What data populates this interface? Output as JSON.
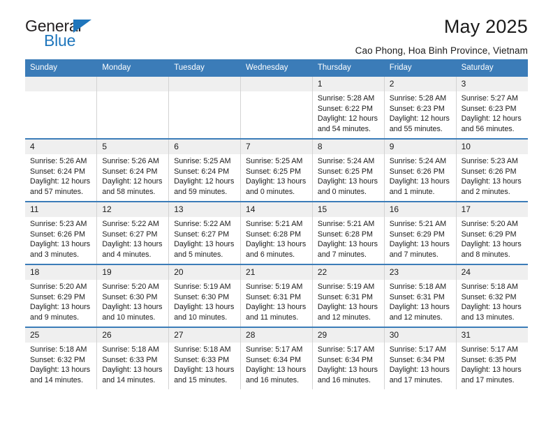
{
  "brand": {
    "name_top": "General",
    "name_bottom": "Blue",
    "accent_color": "#1f76bc"
  },
  "header": {
    "title": "May 2025",
    "subtitle": "Cao Phong, Hoa Binh Province, Vietnam"
  },
  "calendar": {
    "header_bg": "#3b7cb8",
    "daynum_bg": "#efefef",
    "weekday_headers": [
      "Sunday",
      "Monday",
      "Tuesday",
      "Wednesday",
      "Thursday",
      "Friday",
      "Saturday"
    ],
    "labels": {
      "sunrise": "Sunrise:",
      "sunset": "Sunset:",
      "daylight": "Daylight:"
    },
    "weeks": [
      [
        {
          "day": "",
          "empty": true
        },
        {
          "day": "",
          "empty": true
        },
        {
          "day": "",
          "empty": true
        },
        {
          "day": "",
          "empty": true
        },
        {
          "day": "1",
          "sunrise": "Sunrise: 5:28 AM",
          "sunset": "Sunset: 6:22 PM",
          "daylight": "Daylight: 12 hours and 54 minutes."
        },
        {
          "day": "2",
          "sunrise": "Sunrise: 5:28 AM",
          "sunset": "Sunset: 6:23 PM",
          "daylight": "Daylight: 12 hours and 55 minutes."
        },
        {
          "day": "3",
          "sunrise": "Sunrise: 5:27 AM",
          "sunset": "Sunset: 6:23 PM",
          "daylight": "Daylight: 12 hours and 56 minutes."
        }
      ],
      [
        {
          "day": "4",
          "sunrise": "Sunrise: 5:26 AM",
          "sunset": "Sunset: 6:24 PM",
          "daylight": "Daylight: 12 hours and 57 minutes."
        },
        {
          "day": "5",
          "sunrise": "Sunrise: 5:26 AM",
          "sunset": "Sunset: 6:24 PM",
          "daylight": "Daylight: 12 hours and 58 minutes."
        },
        {
          "day": "6",
          "sunrise": "Sunrise: 5:25 AM",
          "sunset": "Sunset: 6:24 PM",
          "daylight": "Daylight: 12 hours and 59 minutes."
        },
        {
          "day": "7",
          "sunrise": "Sunrise: 5:25 AM",
          "sunset": "Sunset: 6:25 PM",
          "daylight": "Daylight: 13 hours and 0 minutes."
        },
        {
          "day": "8",
          "sunrise": "Sunrise: 5:24 AM",
          "sunset": "Sunset: 6:25 PM",
          "daylight": "Daylight: 13 hours and 0 minutes."
        },
        {
          "day": "9",
          "sunrise": "Sunrise: 5:24 AM",
          "sunset": "Sunset: 6:26 PM",
          "daylight": "Daylight: 13 hours and 1 minute."
        },
        {
          "day": "10",
          "sunrise": "Sunrise: 5:23 AM",
          "sunset": "Sunset: 6:26 PM",
          "daylight": "Daylight: 13 hours and 2 minutes."
        }
      ],
      [
        {
          "day": "11",
          "sunrise": "Sunrise: 5:23 AM",
          "sunset": "Sunset: 6:26 PM",
          "daylight": "Daylight: 13 hours and 3 minutes."
        },
        {
          "day": "12",
          "sunrise": "Sunrise: 5:22 AM",
          "sunset": "Sunset: 6:27 PM",
          "daylight": "Daylight: 13 hours and 4 minutes."
        },
        {
          "day": "13",
          "sunrise": "Sunrise: 5:22 AM",
          "sunset": "Sunset: 6:27 PM",
          "daylight": "Daylight: 13 hours and 5 minutes."
        },
        {
          "day": "14",
          "sunrise": "Sunrise: 5:21 AM",
          "sunset": "Sunset: 6:28 PM",
          "daylight": "Daylight: 13 hours and 6 minutes."
        },
        {
          "day": "15",
          "sunrise": "Sunrise: 5:21 AM",
          "sunset": "Sunset: 6:28 PM",
          "daylight": "Daylight: 13 hours and 7 minutes."
        },
        {
          "day": "16",
          "sunrise": "Sunrise: 5:21 AM",
          "sunset": "Sunset: 6:29 PM",
          "daylight": "Daylight: 13 hours and 7 minutes."
        },
        {
          "day": "17",
          "sunrise": "Sunrise: 5:20 AM",
          "sunset": "Sunset: 6:29 PM",
          "daylight": "Daylight: 13 hours and 8 minutes."
        }
      ],
      [
        {
          "day": "18",
          "sunrise": "Sunrise: 5:20 AM",
          "sunset": "Sunset: 6:29 PM",
          "daylight": "Daylight: 13 hours and 9 minutes."
        },
        {
          "day": "19",
          "sunrise": "Sunrise: 5:20 AM",
          "sunset": "Sunset: 6:30 PM",
          "daylight": "Daylight: 13 hours and 10 minutes."
        },
        {
          "day": "20",
          "sunrise": "Sunrise: 5:19 AM",
          "sunset": "Sunset: 6:30 PM",
          "daylight": "Daylight: 13 hours and 10 minutes."
        },
        {
          "day": "21",
          "sunrise": "Sunrise: 5:19 AM",
          "sunset": "Sunset: 6:31 PM",
          "daylight": "Daylight: 13 hours and 11 minutes."
        },
        {
          "day": "22",
          "sunrise": "Sunrise: 5:19 AM",
          "sunset": "Sunset: 6:31 PM",
          "daylight": "Daylight: 13 hours and 12 minutes."
        },
        {
          "day": "23",
          "sunrise": "Sunrise: 5:18 AM",
          "sunset": "Sunset: 6:31 PM",
          "daylight": "Daylight: 13 hours and 12 minutes."
        },
        {
          "day": "24",
          "sunrise": "Sunrise: 5:18 AM",
          "sunset": "Sunset: 6:32 PM",
          "daylight": "Daylight: 13 hours and 13 minutes."
        }
      ],
      [
        {
          "day": "25",
          "sunrise": "Sunrise: 5:18 AM",
          "sunset": "Sunset: 6:32 PM",
          "daylight": "Daylight: 13 hours and 14 minutes."
        },
        {
          "day": "26",
          "sunrise": "Sunrise: 5:18 AM",
          "sunset": "Sunset: 6:33 PM",
          "daylight": "Daylight: 13 hours and 14 minutes."
        },
        {
          "day": "27",
          "sunrise": "Sunrise: 5:18 AM",
          "sunset": "Sunset: 6:33 PM",
          "daylight": "Daylight: 13 hours and 15 minutes."
        },
        {
          "day": "28",
          "sunrise": "Sunrise: 5:17 AM",
          "sunset": "Sunset: 6:34 PM",
          "daylight": "Daylight: 13 hours and 16 minutes."
        },
        {
          "day": "29",
          "sunrise": "Sunrise: 5:17 AM",
          "sunset": "Sunset: 6:34 PM",
          "daylight": "Daylight: 13 hours and 16 minutes."
        },
        {
          "day": "30",
          "sunrise": "Sunrise: 5:17 AM",
          "sunset": "Sunset: 6:34 PM",
          "daylight": "Daylight: 13 hours and 17 minutes."
        },
        {
          "day": "31",
          "sunrise": "Sunrise: 5:17 AM",
          "sunset": "Sunset: 6:35 PM",
          "daylight": "Daylight: 13 hours and 17 minutes."
        }
      ]
    ]
  }
}
